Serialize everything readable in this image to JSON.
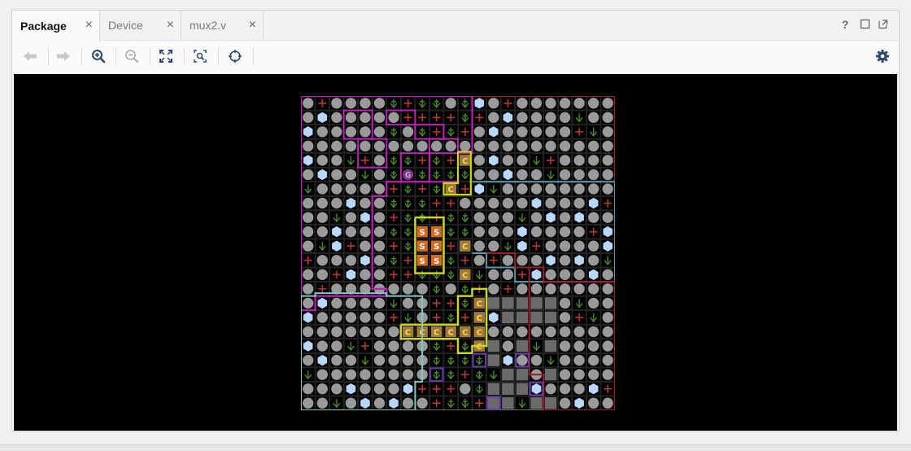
{
  "tabs": [
    {
      "label": "Package",
      "active": true
    },
    {
      "label": "Device",
      "active": false
    },
    {
      "label": "mux2.v",
      "active": false
    }
  ],
  "tab_close_symbol": "×",
  "window_controls": [
    {
      "icon": "help-icon",
      "glyph": "?"
    },
    {
      "icon": "maximize-icon",
      "glyph": "□"
    },
    {
      "icon": "float-window-icon",
      "glyph": "⧉"
    }
  ],
  "toolbar": {
    "buttons": [
      {
        "icon": "back-arrow-icon",
        "enabled": false
      },
      {
        "icon": "forward-arrow-icon",
        "enabled": false
      },
      {
        "icon": "zoom-in-icon",
        "enabled": true
      },
      {
        "icon": "zoom-out-icon",
        "enabled": false
      },
      {
        "icon": "zoom-fit-icon",
        "enabled": true
      },
      {
        "icon": "zoom-area-icon",
        "enabled": true
      },
      {
        "icon": "autofit-selection-icon",
        "enabled": true
      }
    ],
    "settings_icon": "gear-icon"
  },
  "package_view": {
    "background": "#000000",
    "grid_rows": 22,
    "grid_cols": 22,
    "pin_markers": {
      "gnd": "G",
      "config": "C",
      "sense": "S"
    },
    "bank_colors": {
      "bank_magenta": "#c020b8",
      "bank_teal": "#5a9ab0",
      "bank_red": "#9a1e30",
      "bank_cyan": "#80c8c0",
      "bank_yellow": "#c8d820",
      "bank_purple": "#6a3aa8"
    },
    "colors": {
      "io_pin": "#9a9a9a",
      "hex_pin": "#b8d8ff",
      "power_pin": "#b83838",
      "ground_pin": "#4a8a2a",
      "config_pin": "#a07a3a",
      "sense_pin": "#d06a20"
    }
  }
}
